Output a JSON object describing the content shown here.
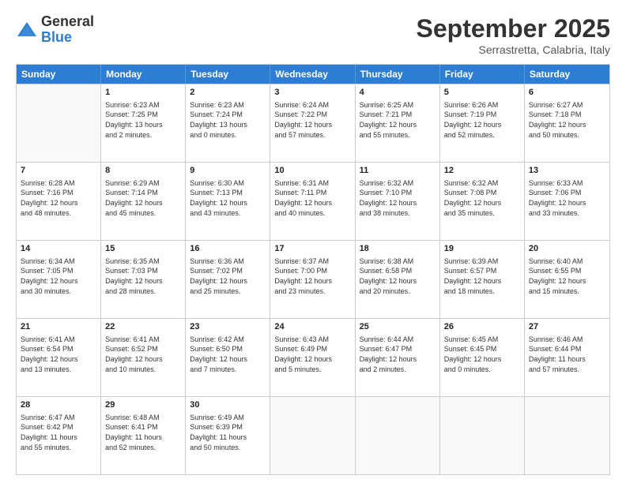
{
  "logo": {
    "general": "General",
    "blue": "Blue"
  },
  "header": {
    "month": "September 2025",
    "location": "Serrastretta, Calabria, Italy"
  },
  "days": [
    "Sunday",
    "Monday",
    "Tuesday",
    "Wednesday",
    "Thursday",
    "Friday",
    "Saturday"
  ],
  "weeks": [
    [
      {
        "day": "",
        "info": ""
      },
      {
        "day": "1",
        "info": "Sunrise: 6:23 AM\nSunset: 7:25 PM\nDaylight: 13 hours\nand 2 minutes."
      },
      {
        "day": "2",
        "info": "Sunrise: 6:23 AM\nSunset: 7:24 PM\nDaylight: 13 hours\nand 0 minutes."
      },
      {
        "day": "3",
        "info": "Sunrise: 6:24 AM\nSunset: 7:22 PM\nDaylight: 12 hours\nand 57 minutes."
      },
      {
        "day": "4",
        "info": "Sunrise: 6:25 AM\nSunset: 7:21 PM\nDaylight: 12 hours\nand 55 minutes."
      },
      {
        "day": "5",
        "info": "Sunrise: 6:26 AM\nSunset: 7:19 PM\nDaylight: 12 hours\nand 52 minutes."
      },
      {
        "day": "6",
        "info": "Sunrise: 6:27 AM\nSunset: 7:18 PM\nDaylight: 12 hours\nand 50 minutes."
      }
    ],
    [
      {
        "day": "7",
        "info": "Sunrise: 6:28 AM\nSunset: 7:16 PM\nDaylight: 12 hours\nand 48 minutes."
      },
      {
        "day": "8",
        "info": "Sunrise: 6:29 AM\nSunset: 7:14 PM\nDaylight: 12 hours\nand 45 minutes."
      },
      {
        "day": "9",
        "info": "Sunrise: 6:30 AM\nSunset: 7:13 PM\nDaylight: 12 hours\nand 43 minutes."
      },
      {
        "day": "10",
        "info": "Sunrise: 6:31 AM\nSunset: 7:11 PM\nDaylight: 12 hours\nand 40 minutes."
      },
      {
        "day": "11",
        "info": "Sunrise: 6:32 AM\nSunset: 7:10 PM\nDaylight: 12 hours\nand 38 minutes."
      },
      {
        "day": "12",
        "info": "Sunrise: 6:32 AM\nSunset: 7:08 PM\nDaylight: 12 hours\nand 35 minutes."
      },
      {
        "day": "13",
        "info": "Sunrise: 6:33 AM\nSunset: 7:06 PM\nDaylight: 12 hours\nand 33 minutes."
      }
    ],
    [
      {
        "day": "14",
        "info": "Sunrise: 6:34 AM\nSunset: 7:05 PM\nDaylight: 12 hours\nand 30 minutes."
      },
      {
        "day": "15",
        "info": "Sunrise: 6:35 AM\nSunset: 7:03 PM\nDaylight: 12 hours\nand 28 minutes."
      },
      {
        "day": "16",
        "info": "Sunrise: 6:36 AM\nSunset: 7:02 PM\nDaylight: 12 hours\nand 25 minutes."
      },
      {
        "day": "17",
        "info": "Sunrise: 6:37 AM\nSunset: 7:00 PM\nDaylight: 12 hours\nand 23 minutes."
      },
      {
        "day": "18",
        "info": "Sunrise: 6:38 AM\nSunset: 6:58 PM\nDaylight: 12 hours\nand 20 minutes."
      },
      {
        "day": "19",
        "info": "Sunrise: 6:39 AM\nSunset: 6:57 PM\nDaylight: 12 hours\nand 18 minutes."
      },
      {
        "day": "20",
        "info": "Sunrise: 6:40 AM\nSunset: 6:55 PM\nDaylight: 12 hours\nand 15 minutes."
      }
    ],
    [
      {
        "day": "21",
        "info": "Sunrise: 6:41 AM\nSunset: 6:54 PM\nDaylight: 12 hours\nand 13 minutes."
      },
      {
        "day": "22",
        "info": "Sunrise: 6:41 AM\nSunset: 6:52 PM\nDaylight: 12 hours\nand 10 minutes."
      },
      {
        "day": "23",
        "info": "Sunrise: 6:42 AM\nSunset: 6:50 PM\nDaylight: 12 hours\nand 7 minutes."
      },
      {
        "day": "24",
        "info": "Sunrise: 6:43 AM\nSunset: 6:49 PM\nDaylight: 12 hours\nand 5 minutes."
      },
      {
        "day": "25",
        "info": "Sunrise: 6:44 AM\nSunset: 6:47 PM\nDaylight: 12 hours\nand 2 minutes."
      },
      {
        "day": "26",
        "info": "Sunrise: 6:45 AM\nSunset: 6:45 PM\nDaylight: 12 hours\nand 0 minutes."
      },
      {
        "day": "27",
        "info": "Sunrise: 6:46 AM\nSunset: 6:44 PM\nDaylight: 11 hours\nand 57 minutes."
      }
    ],
    [
      {
        "day": "28",
        "info": "Sunrise: 6:47 AM\nSunset: 6:42 PM\nDaylight: 11 hours\nand 55 minutes."
      },
      {
        "day": "29",
        "info": "Sunrise: 6:48 AM\nSunset: 6:41 PM\nDaylight: 11 hours\nand 52 minutes."
      },
      {
        "day": "30",
        "info": "Sunrise: 6:49 AM\nSunset: 6:39 PM\nDaylight: 11 hours\nand 50 minutes."
      },
      {
        "day": "",
        "info": ""
      },
      {
        "day": "",
        "info": ""
      },
      {
        "day": "",
        "info": ""
      },
      {
        "day": "",
        "info": ""
      }
    ]
  ]
}
